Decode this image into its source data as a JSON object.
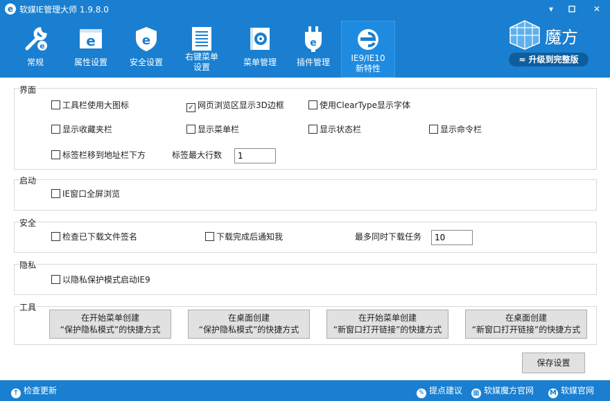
{
  "app": {
    "title": "软媒IE管理大师 1.9.8.0",
    "logo_letter": "e"
  },
  "window_controls": {
    "minimize": "▾",
    "restore": "□",
    "maximize": "–",
    "close": "✕"
  },
  "tabs": [
    {
      "label": "常规",
      "icon": "wrench-e-icon"
    },
    {
      "label": "属性设置",
      "icon": "window-e-icon"
    },
    {
      "label": "安全设置",
      "icon": "shield-e-icon"
    },
    {
      "label": "右键菜单\n设置",
      "icon": "context-menu-icon"
    },
    {
      "label": "菜单管理",
      "icon": "gear-box-icon"
    },
    {
      "label": "插件管理",
      "icon": "plug-e-icon"
    },
    {
      "label": "IE9/IE10\n新特性",
      "icon": "ie-logo-icon",
      "active": true
    }
  ],
  "brand": {
    "name": "魔方",
    "upgrade_label": "升级到完整版"
  },
  "groups": {
    "interface": {
      "title": "界面",
      "toolbar_large_icons": {
        "label": "工具栏使用大图标",
        "checked": false
      },
      "webpage_3d_border": {
        "label": "网页浏览区显示3D边框",
        "checked": true
      },
      "cleartype": {
        "label": "使用ClearType显示字体",
        "checked": false
      },
      "favorites_bar": {
        "label": "显示收藏夹栏",
        "checked": false
      },
      "menu_bar": {
        "label": "显示菜单栏",
        "checked": false
      },
      "status_bar": {
        "label": "显示状态栏",
        "checked": false
      },
      "command_bar": {
        "label": "显示命令栏",
        "checked": false
      },
      "tabs_below_address": {
        "label": "标签栏移到地址栏下方",
        "checked": false
      },
      "max_tab_rows_label": "标签最大行数",
      "max_tab_rows_value": "1"
    },
    "startup": {
      "title": "启动",
      "fullscreen": {
        "label": "IE窗口全屏浏览",
        "checked": false
      }
    },
    "security": {
      "title": "安全",
      "check_signature": {
        "label": "检查已下载文件签名",
        "checked": false
      },
      "notify_download": {
        "label": "下载完成后通知我",
        "checked": false
      },
      "max_downloads_label": "最多同时下载任务",
      "max_downloads_value": "10"
    },
    "privacy": {
      "title": "隐私",
      "inprivate_start": {
        "label": "以隐私保护模式启动IE9",
        "checked": false
      }
    },
    "tools": {
      "title": "工具",
      "buttons": [
        {
          "line1": "在开始菜单创建",
          "line2": "“保护隐私模式”的快捷方式"
        },
        {
          "line1": "在桌面创建",
          "line2": "“保护隐私模式”的快捷方式"
        },
        {
          "line1": "在开始菜单创建",
          "line2": "“新窗口打开链接”的快捷方式"
        },
        {
          "line1": "在桌面创建",
          "line2": "“新窗口打开链接”的快捷方式"
        }
      ]
    }
  },
  "save_label": "保存设置",
  "status": {
    "check_update": "检查更新",
    "feedback": "提点建议",
    "mofang_site": "软媒魔方官网",
    "ruanmei_site": "软媒官网"
  },
  "colors": {
    "accent": "#1a7fd0",
    "accent_dark": "#0e5e9e"
  }
}
